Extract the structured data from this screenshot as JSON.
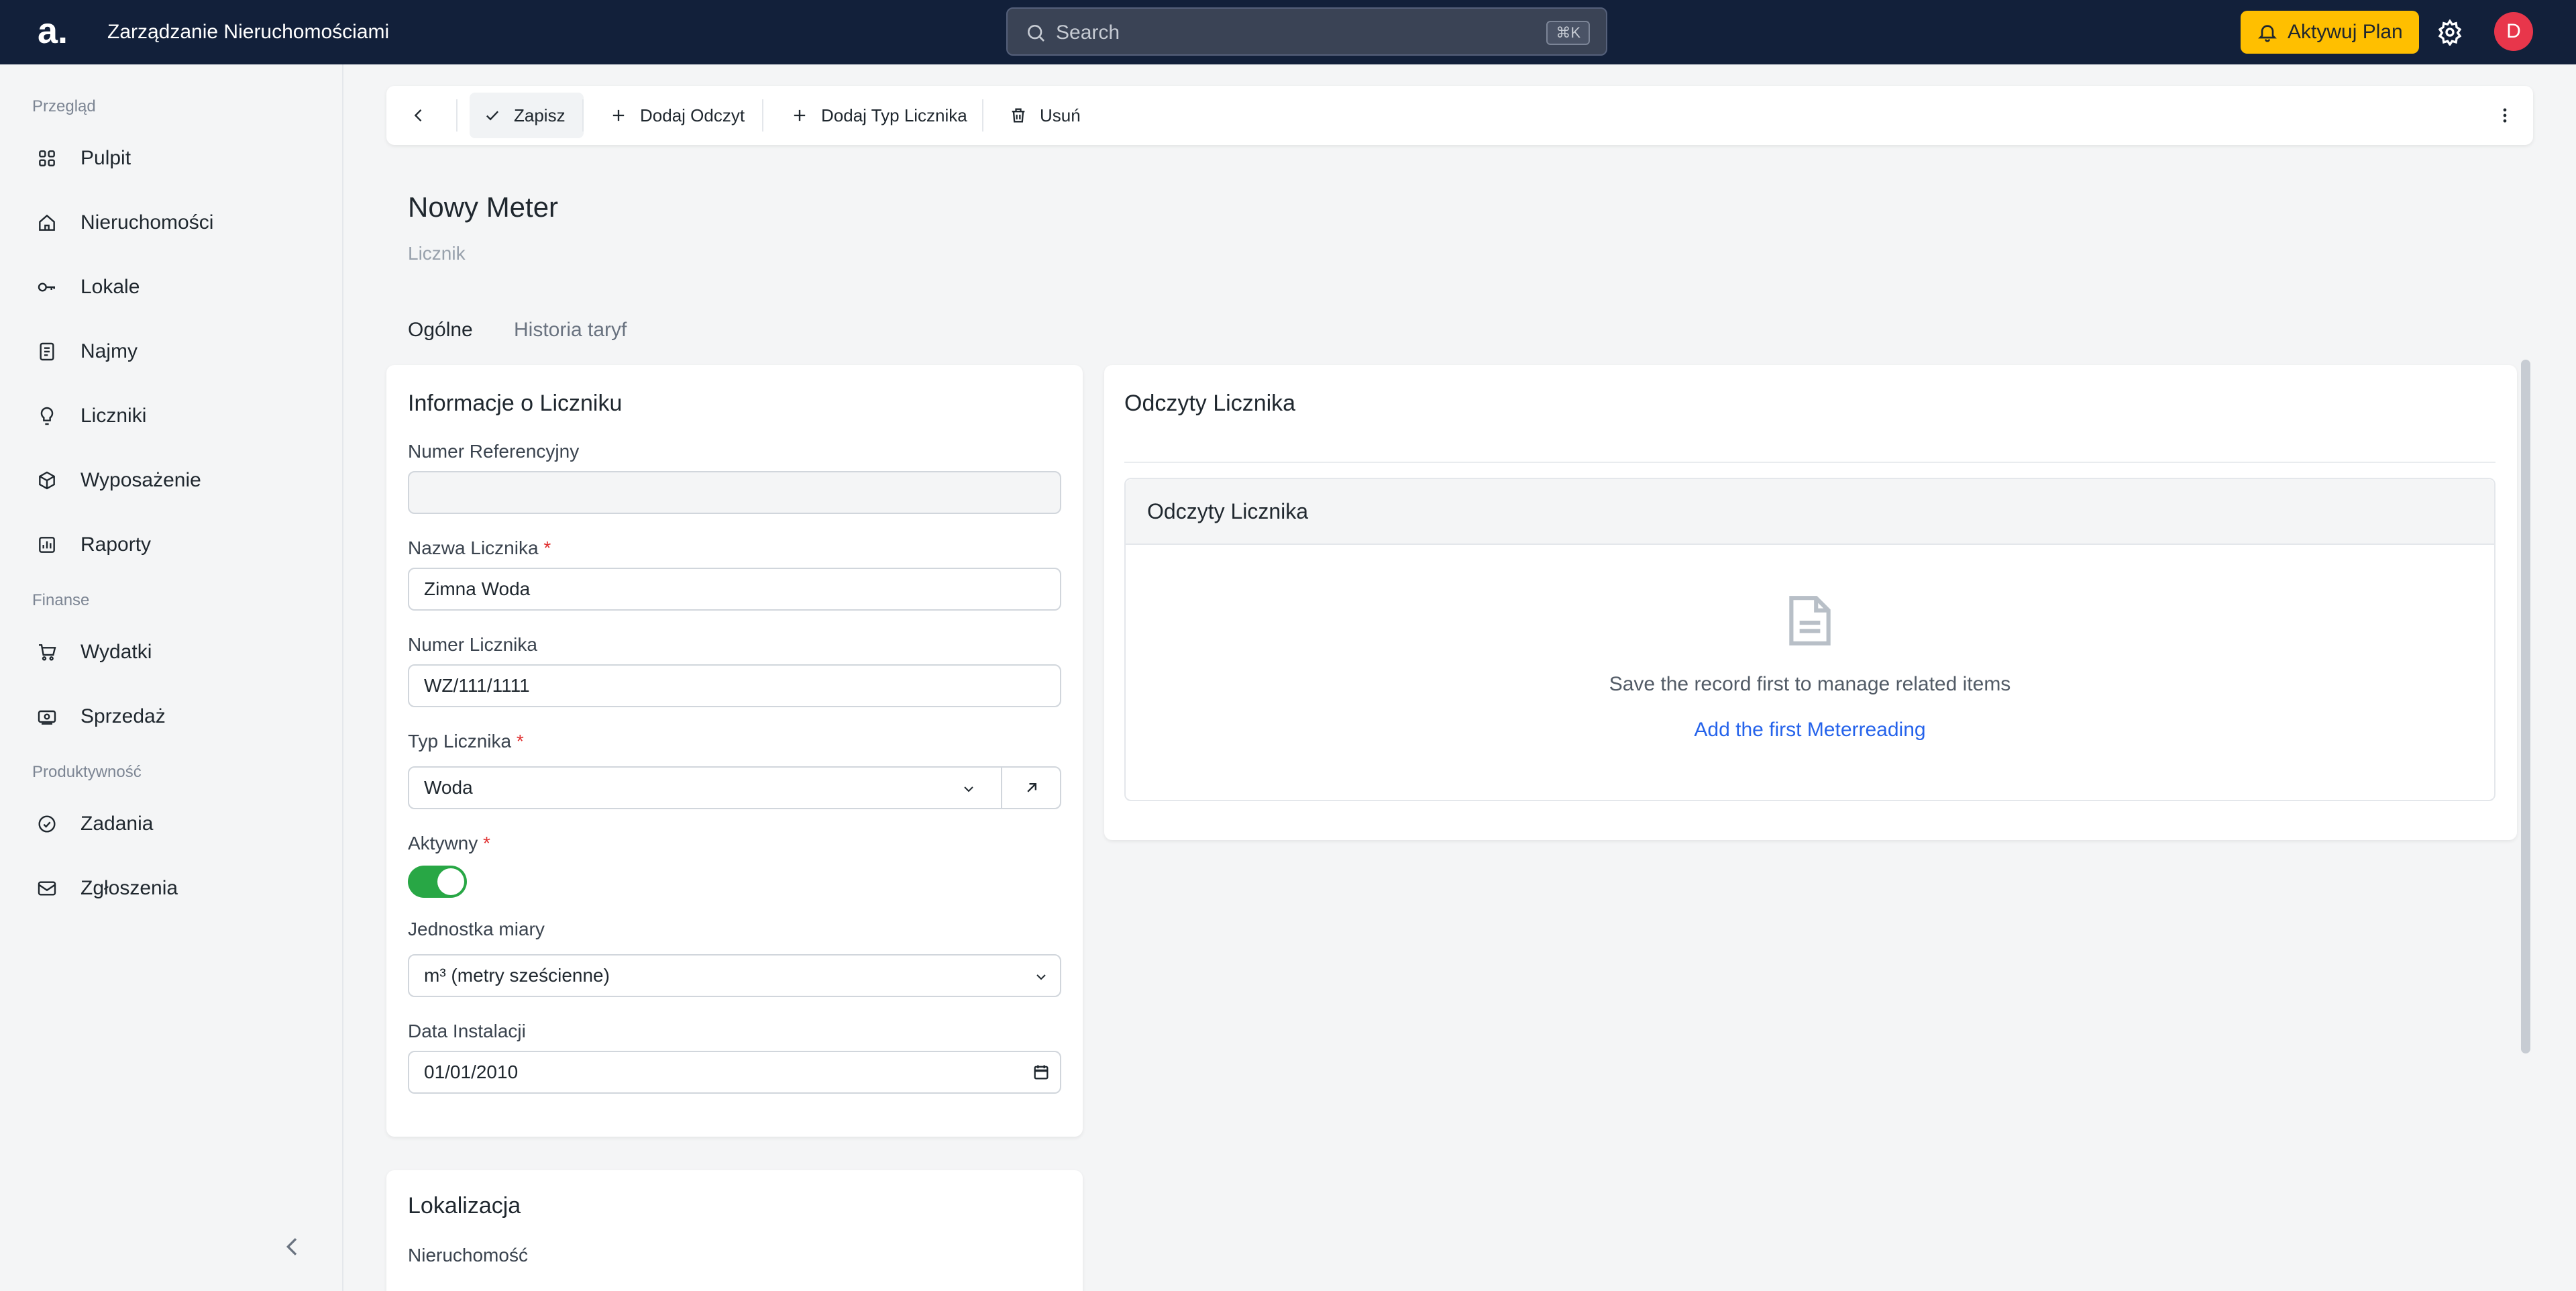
{
  "header": {
    "logo_text": "a.",
    "app_title": "Zarządzanie Nieruchomościami",
    "search_placeholder": "Search",
    "search_shortcut": "⌘K",
    "plan_button": "Aktywuj Plan",
    "avatar_initial": "D"
  },
  "sidebar": {
    "sections": [
      {
        "title": "Przegląd",
        "items": [
          {
            "label": "Pulpit",
            "icon": "grid-icon"
          },
          {
            "label": "Nieruchomości",
            "icon": "home-icon"
          },
          {
            "label": "Lokale",
            "icon": "key-icon"
          },
          {
            "label": "Najmy",
            "icon": "document-icon"
          },
          {
            "label": "Liczniki",
            "icon": "bulb-icon"
          },
          {
            "label": "Wyposażenie",
            "icon": "box-icon"
          },
          {
            "label": "Raporty",
            "icon": "chart-icon"
          }
        ]
      },
      {
        "title": "Finanse",
        "items": [
          {
            "label": "Wydatki",
            "icon": "cart-icon"
          },
          {
            "label": "Sprzedaż",
            "icon": "cash-icon"
          }
        ]
      },
      {
        "title": "Produktywność",
        "items": [
          {
            "label": "Zadania",
            "icon": "check-circle-icon"
          },
          {
            "label": "Zgłoszenia",
            "icon": "mail-icon"
          }
        ]
      }
    ]
  },
  "toolbar": {
    "save": "Zapisz",
    "add_reading": "Dodaj Odczyt",
    "add_meter_type": "Dodaj Typ Licznika",
    "delete": "Usuń"
  },
  "page": {
    "title": "Nowy Meter",
    "subtitle": "Licznik",
    "tabs": [
      "Ogólne",
      "Historia taryf"
    ],
    "active_tab": "Ogólne"
  },
  "info_card": {
    "title": "Informacje o Liczniku",
    "fields": {
      "ref_number": {
        "label": "Numer Referencyjny",
        "value": ""
      },
      "meter_name": {
        "label": "Nazwa Licznika",
        "value": "Zimna Woda",
        "required": "*"
      },
      "meter_number": {
        "label": "Numer Licznika",
        "value": "WZ/111/1111"
      },
      "meter_type": {
        "label": "Typ Licznika",
        "value": "Woda",
        "required": "*"
      },
      "active": {
        "label": "Aktywny",
        "value": true,
        "required": "*"
      },
      "unit": {
        "label": "Jednostka miary",
        "value": "m³ (metry sześcienne)"
      },
      "install_date": {
        "label": "Data Instalacji",
        "value": "01/01/2010"
      }
    }
  },
  "location_card": {
    "title": "Lokalizacja",
    "property_label": "Nieruchomość"
  },
  "readings_card": {
    "title": "Odczyty Licznika",
    "inner_title": "Odczyty Licznika",
    "empty_message": "Save the record first to manage related items",
    "add_link": "Add the first Meterreading"
  },
  "colors": {
    "header_bg": "#12203a",
    "accent_yellow": "#ffbf00",
    "toggle_on": "#28a745",
    "link_blue": "#2563eb",
    "avatar_bg": "#e8364b"
  }
}
